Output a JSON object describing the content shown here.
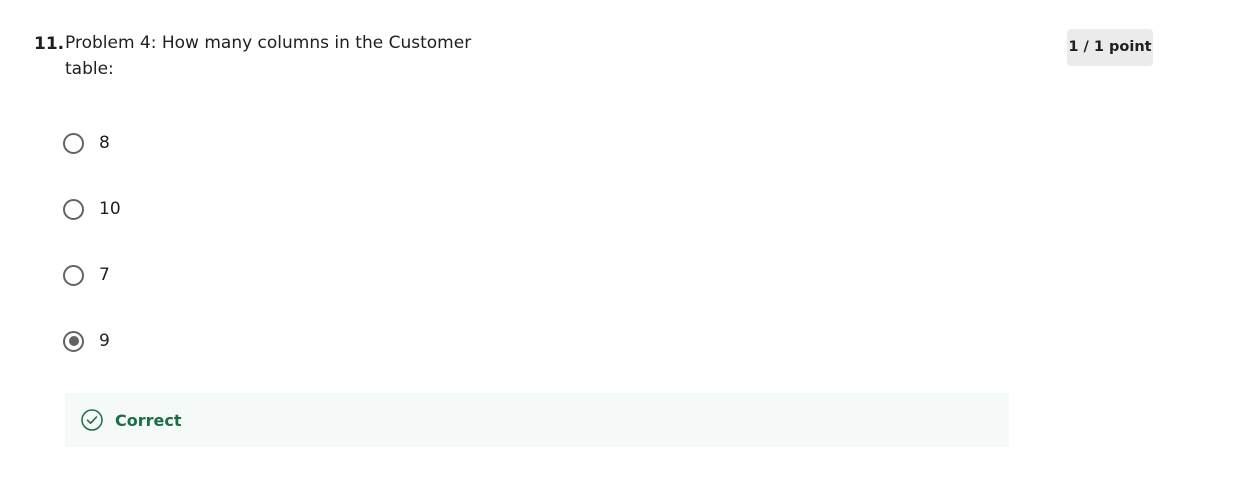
{
  "question": {
    "number": "11.",
    "text": "Problem 4: How many columns in the Customer table:"
  },
  "points": {
    "label": "1 / 1 point"
  },
  "options": [
    {
      "label": "8",
      "selected": false
    },
    {
      "label": "10",
      "selected": false
    },
    {
      "label": "7",
      "selected": false
    },
    {
      "label": "9",
      "selected": true
    }
  ],
  "feedback": {
    "label": "Correct",
    "icon": "check-circle-icon",
    "color": "#1a6e48"
  }
}
